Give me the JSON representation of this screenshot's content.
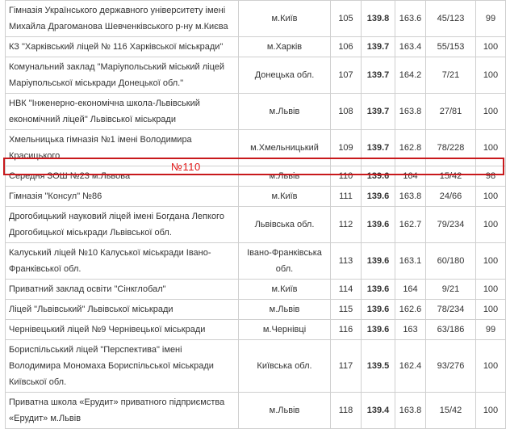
{
  "rows": [
    {
      "name": "Гімназія Українського державного університету імені Михайла Драгоманова Шевченківського р-ну м.Києва",
      "region": "м.Київ",
      "rank": "105",
      "score": "139.8",
      "s2": "163.6",
      "ratio": "45/123",
      "pct": "99"
    },
    {
      "name": "КЗ \"Харківський ліцей № 116 Харківської міськради\"",
      "region": "м.Харків",
      "rank": "106",
      "score": "139.7",
      "s2": "163.4",
      "ratio": "55/153",
      "pct": "100"
    },
    {
      "name": "Комунальний заклад \"Маріупольський міський ліцей Маріупольської міськради Донецької обл.\"",
      "region": "Донецька обл.",
      "rank": "107",
      "score": "139.7",
      "s2": "164.2",
      "ratio": "7/21",
      "pct": "100"
    },
    {
      "name": "НВК \"Інженерно-економічна школа-Львівський економічний ліцей\" Львівської міськради",
      "region": "м.Львів",
      "rank": "108",
      "score": "139.7",
      "s2": "163.8",
      "ratio": "27/81",
      "pct": "100"
    },
    {
      "name": "Хмельницька гімназія №1 імені Володимира Красицького",
      "region": "м.Хмельницький",
      "rank": "109",
      "score": "139.7",
      "s2": "162.8",
      "ratio": "78/228",
      "pct": "100"
    },
    {
      "name": "Середня ЗОШ №23 м.Львова",
      "region": "м.Львів",
      "rank": "110",
      "score": "139.6",
      "s2": "164",
      "ratio": "15/42",
      "pct": "98"
    },
    {
      "name": "Гімназія \"Консул\" №86",
      "region": "м.Київ",
      "rank": "111",
      "score": "139.6",
      "s2": "163.8",
      "ratio": "24/66",
      "pct": "100"
    },
    {
      "name": "Дрогобицький науковий ліцей імені Богдана Лепкого Дрогобицької міськради Львівської обл.",
      "region": "Львівська обл.",
      "rank": "112",
      "score": "139.6",
      "s2": "162.7",
      "ratio": "79/234",
      "pct": "100"
    },
    {
      "name": "Калуський ліцей №10 Калуської міськради Івано-Франківської обл.",
      "region": "Івано-Франківська обл.",
      "rank": "113",
      "score": "139.6",
      "s2": "163.1",
      "ratio": "60/180",
      "pct": "100"
    },
    {
      "name": "Приватний заклад освіти \"Сінкглобал\"",
      "region": "м.Київ",
      "rank": "114",
      "score": "139.6",
      "s2": "164",
      "ratio": "9/21",
      "pct": "100"
    },
    {
      "name": "Ліцей \"Львівський\" Львівської міськради",
      "region": "м.Львів",
      "rank": "115",
      "score": "139.6",
      "s2": "162.6",
      "ratio": "78/234",
      "pct": "100"
    },
    {
      "name": "Чернівецький ліцей №9 Чернівецької міськради",
      "region": "м.Чернівці",
      "rank": "116",
      "score": "139.6",
      "s2": "163",
      "ratio": "63/186",
      "pct": "99"
    },
    {
      "name": "Бориспільський ліцей \"Перспектива\" імені Володимира Мономаха Бориспільської міськради Київської обл.",
      "region": "Київська обл.",
      "rank": "117",
      "score": "139.5",
      "s2": "162.4",
      "ratio": "93/276",
      "pct": "100"
    },
    {
      "name": "Приватна школа «Ерудит» приватного підприємства «Ерудит» м.Львів",
      "region": "м.Львів",
      "rank": "118",
      "score": "139.4",
      "s2": "163.8",
      "ratio": "15/42",
      "pct": "100"
    }
  ],
  "annotation": "№110",
  "highlight_color": "#c8191c"
}
